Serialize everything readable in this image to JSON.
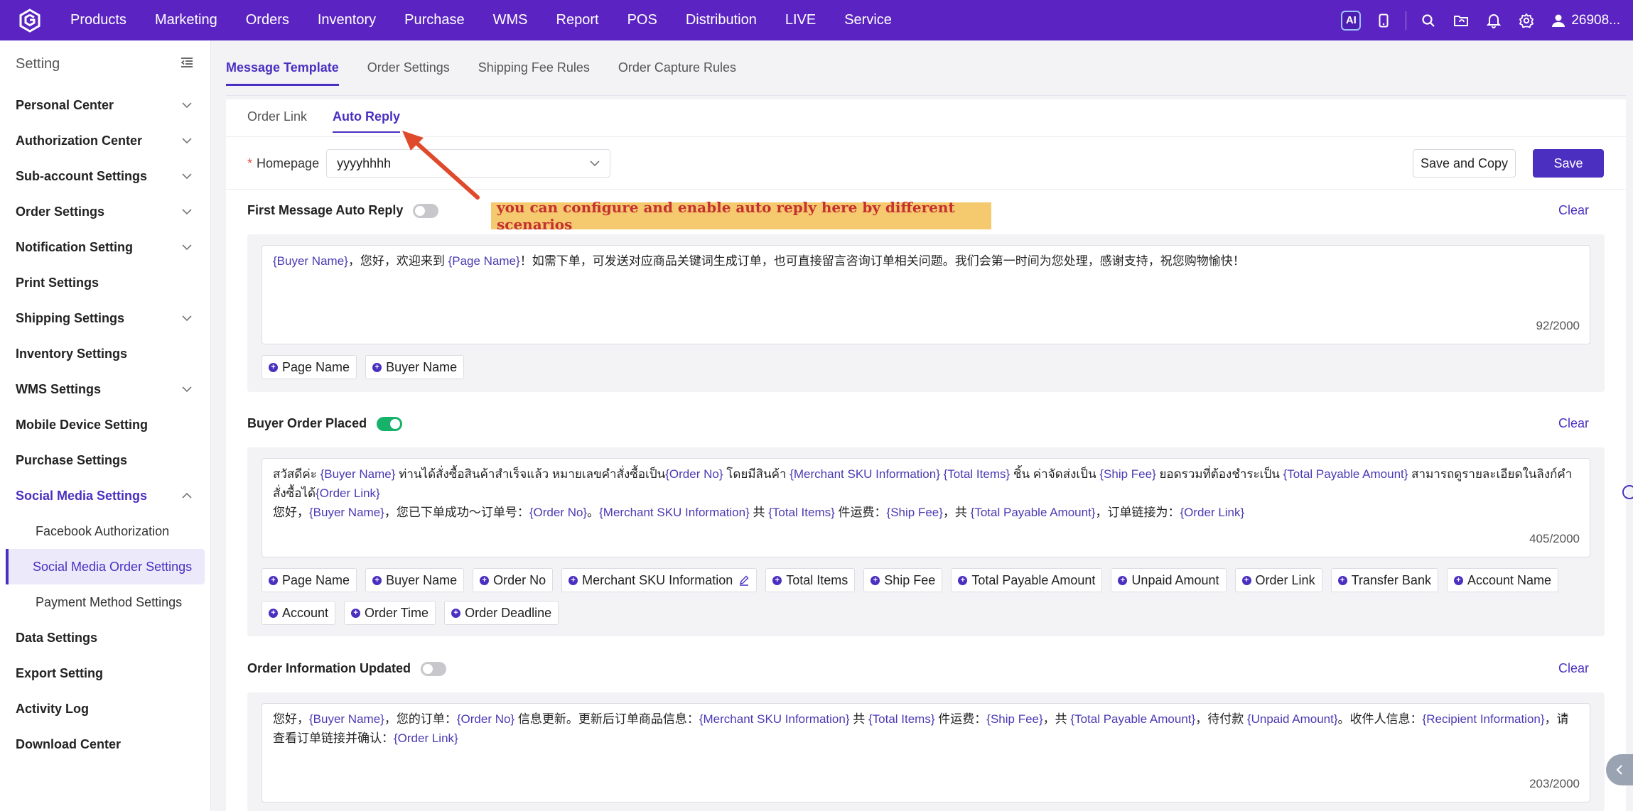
{
  "topnav": {
    "items": [
      "Products",
      "Marketing",
      "Orders",
      "Inventory",
      "Purchase",
      "WMS",
      "Report",
      "POS",
      "Distribution",
      "LIVE",
      "Service"
    ],
    "ai_label": "AI",
    "user_name": "26908..."
  },
  "sidebar": {
    "title": "Setting",
    "items": [
      {
        "label": "Personal Center",
        "chevron": "down"
      },
      {
        "label": "Authorization Center",
        "chevron": "down"
      },
      {
        "label": "Sub-account Settings",
        "chevron": "down"
      },
      {
        "label": "Order Settings",
        "chevron": "down"
      },
      {
        "label": "Notification Setting",
        "chevron": "down"
      },
      {
        "label": "Print Settings",
        "chevron": ""
      },
      {
        "label": "Shipping Settings",
        "chevron": "down"
      },
      {
        "label": "Inventory Settings",
        "chevron": ""
      },
      {
        "label": "WMS Settings",
        "chevron": "down"
      },
      {
        "label": "Mobile Device Setting",
        "chevron": ""
      },
      {
        "label": "Purchase Settings",
        "chevron": ""
      },
      {
        "label": "Social Media Settings",
        "chevron": "up"
      },
      {
        "label": "Data Settings",
        "chevron": ""
      },
      {
        "label": "Export Setting",
        "chevron": ""
      },
      {
        "label": "Activity Log",
        "chevron": ""
      },
      {
        "label": "Download Center",
        "chevron": ""
      }
    ],
    "sub_items": [
      "Facebook Authorization",
      "Social Media Order Settings",
      "Payment Method Settings"
    ]
  },
  "tabs": [
    "Message Template",
    "Order Settings",
    "Shipping Fee Rules",
    "Order Capture Rules"
  ],
  "subtabs": [
    "Order Link",
    "Auto Reply"
  ],
  "homepage": {
    "required_mark": "*",
    "label": "Homepage",
    "value": "yyyyhhhh"
  },
  "buttons": {
    "save_copy": "Save and Copy",
    "save": "Save"
  },
  "annotation": "you can configure and enable auto reply here by different scenarios",
  "sections": {
    "first": {
      "title": "First Message Auto Reply",
      "enabled": false,
      "clear": "Clear",
      "counter": "92/2000",
      "chips": [
        "Page Name",
        "Buyer Name"
      ]
    },
    "buyer": {
      "title": "Buyer Order Placed",
      "enabled": true,
      "clear": "Clear",
      "counter": "405/2000",
      "chips": [
        "Page Name",
        "Buyer Name",
        "Order No",
        "Merchant SKU Information",
        "Total Items",
        "Ship Fee",
        "Total Payable Amount",
        "Unpaid Amount",
        "Order Link",
        "Transfer Bank",
        "Account Name",
        "Account",
        "Order Time",
        "Order Deadline"
      ]
    },
    "updated": {
      "title": "Order Information Updated",
      "enabled": false,
      "clear": "Clear",
      "counter": "203/2000"
    }
  },
  "messages": {
    "first": [
      {
        "t": "{Buyer Name}",
        "v": true
      },
      {
        "t": "，您好，欢迎来到 ",
        "v": false
      },
      {
        "t": "{Page Name}",
        "v": true
      },
      {
        "t": "！如需下单，可发送对应商品关键词生成订单，也可直接留言咨询订单相关问题。我们会第一时间为您处理，感谢支持，祝您购物愉快！",
        "v": false
      }
    ],
    "buyer_line1": [
      {
        "t": "สวัสดีค่ะ ",
        "v": false
      },
      {
        "t": "{Buyer Name}",
        "v": true
      },
      {
        "t": " ท่านได้สั่งซื้อสินค้าสำเร็จแล้ว หมายเลขคำสั่งซื้อเป็น",
        "v": false
      },
      {
        "t": "{Order No}",
        "v": true
      },
      {
        "t": " โดยมีสินค้า ",
        "v": false
      },
      {
        "t": "{Merchant SKU Information}",
        "v": true
      },
      {
        "t": " ",
        "v": false
      },
      {
        "t": "{Total Items}",
        "v": true
      },
      {
        "t": " ชิ้น ค่าจัดส่งเป็น ",
        "v": false
      },
      {
        "t": "{Ship Fee}",
        "v": true
      },
      {
        "t": " ยอดรวมที่ต้องชำระเป็น ",
        "v": false
      },
      {
        "t": "{Total Payable Amount}",
        "v": true
      },
      {
        "t": " สามารถดูรายละเอียดในลิงก์คำสั่งซื้อได้",
        "v": false
      },
      {
        "t": "{Order Link}",
        "v": true
      }
    ],
    "buyer_line2": [
      {
        "t": "您好，",
        "v": false
      },
      {
        "t": "{Buyer Name}",
        "v": true
      },
      {
        "t": "，您已下单成功～订单号：",
        "v": false
      },
      {
        "t": "{Order No}",
        "v": true
      },
      {
        "t": "。",
        "v": false
      },
      {
        "t": "{Merchant SKU Information}",
        "v": true
      },
      {
        "t": " 共 ",
        "v": false
      },
      {
        "t": "{Total Items}",
        "v": true
      },
      {
        "t": " 件运费：",
        "v": false
      },
      {
        "t": "{Ship Fee}",
        "v": true
      },
      {
        "t": "，共 ",
        "v": false
      },
      {
        "t": "{Total Payable Amount}",
        "v": true
      },
      {
        "t": "，订单链接为：",
        "v": false
      },
      {
        "t": "{Order Link}",
        "v": true
      }
    ],
    "updated": [
      {
        "t": "您好，",
        "v": false
      },
      {
        "t": "{Buyer Name}",
        "v": true
      },
      {
        "t": "，您的订单：",
        "v": false
      },
      {
        "t": "{Order No}",
        "v": true
      },
      {
        "t": " 信息更新。更新后订单商品信息：",
        "v": false
      },
      {
        "t": "{Merchant SKU Information}",
        "v": true
      },
      {
        "t": " 共 ",
        "v": false
      },
      {
        "t": "{Total Items}",
        "v": true
      },
      {
        "t": " 件运费：",
        "v": false
      },
      {
        "t": "{Ship Fee}",
        "v": true
      },
      {
        "t": "，共 ",
        "v": false
      },
      {
        "t": "{Total Payable Amount}",
        "v": true
      },
      {
        "t": "，待付款 ",
        "v": false
      },
      {
        "t": "{Unpaid Amount}",
        "v": true
      },
      {
        "t": "。收件人信息：",
        "v": false
      },
      {
        "t": "{Recipient Information}",
        "v": true
      },
      {
        "t": "，请查看订单链接并确认：",
        "v": false
      },
      {
        "t": "{Order Link}",
        "v": true
      }
    ]
  },
  "colors": {
    "brand": "#5b24c2",
    "accent": "#4a2fc0",
    "toggle_on": "#17b26a",
    "annotation_bg": "#f5c96d",
    "annotation_text": "#c53030"
  }
}
